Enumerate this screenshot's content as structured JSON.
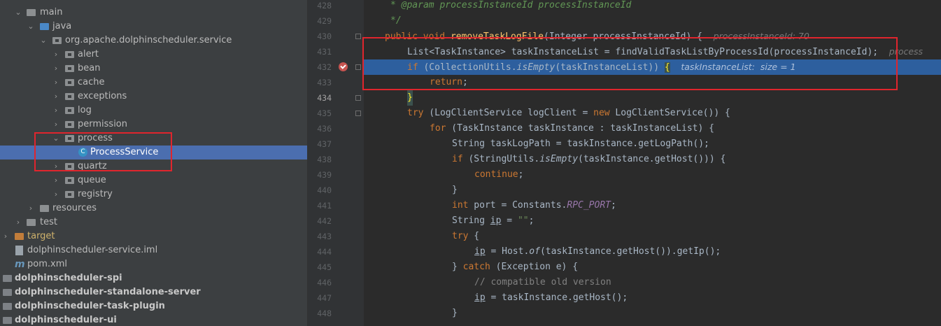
{
  "tree": {
    "items": [
      {
        "label": "main",
        "kind": "folder",
        "expanded": true
      },
      {
        "label": "java",
        "kind": "folder",
        "expanded": true
      },
      {
        "label": "org.apache.dolphinscheduler.service",
        "kind": "package",
        "expanded": true
      },
      {
        "label": "alert",
        "kind": "package",
        "expanded": false
      },
      {
        "label": "bean",
        "kind": "package",
        "expanded": false
      },
      {
        "label": "cache",
        "kind": "package",
        "expanded": false
      },
      {
        "label": "exceptions",
        "kind": "package",
        "expanded": false
      },
      {
        "label": "log",
        "kind": "package",
        "expanded": false
      },
      {
        "label": "permission",
        "kind": "package",
        "expanded": false
      },
      {
        "label": "process",
        "kind": "package",
        "expanded": true
      },
      {
        "label": "ProcessService",
        "kind": "class",
        "selected": true
      },
      {
        "label": "quartz",
        "kind": "package",
        "expanded": false
      },
      {
        "label": "queue",
        "kind": "package",
        "expanded": false
      },
      {
        "label": "registry",
        "kind": "package",
        "expanded": false
      },
      {
        "label": "resources",
        "kind": "folder",
        "expanded": false
      },
      {
        "label": "test",
        "kind": "folder",
        "expanded": false
      },
      {
        "label": "target",
        "kind": "folder-excluded",
        "expanded": false
      },
      {
        "label": "dolphinscheduler-service.iml",
        "kind": "iml"
      },
      {
        "label": "pom.xml",
        "kind": "maven"
      },
      {
        "label": "dolphinscheduler-spi",
        "kind": "module"
      },
      {
        "label": "dolphinscheduler-standalone-server",
        "kind": "module"
      },
      {
        "label": "dolphinscheduler-task-plugin",
        "kind": "module"
      },
      {
        "label": "dolphinscheduler-ui",
        "kind": "module"
      }
    ]
  },
  "editor": {
    "line_numbers": [
      "428",
      "429",
      "430",
      "431",
      "432",
      "433",
      "434",
      "435",
      "436",
      "437",
      "438",
      "439",
      "440",
      "441",
      "442",
      "443",
      "444",
      "445",
      "446",
      "447",
      "448"
    ],
    "current_line": "432",
    "breakpoint_line": "432",
    "lines": {
      "l428": {
        "javadoc": "* @param processInstanceId processInstanceId",
        "tag": "@param"
      },
      "l429": {
        "javadoc_end": "*/"
      },
      "l430": {
        "kw1": "public",
        "kw2": "void",
        "method": "removeTaskLogFile",
        "rest": "(Integer processInstanceId) {",
        "hint": "processInstanceId: 70"
      },
      "l431": {
        "code": "List<TaskInstance> taskInstanceList = findValidTaskListByProcessId(processInstanceId);",
        "hint": "process"
      },
      "l432": {
        "kw": "if",
        "pre": " (CollectionUtils.",
        "call": "isEmpty",
        "post": "(taskInstanceList)) ",
        "brace": "{",
        "hint": "taskInstanceList:  size = 1"
      },
      "l433": {
        "kw": "return",
        "post": ";"
      },
      "l434": {
        "brace": "}"
      },
      "l435": {
        "kw": "try",
        "pre": " (LogClientService logClient = ",
        "kw2": "new",
        "post": " LogClientService()) {"
      },
      "l436": {
        "kw": "for",
        "post": " (TaskInstance taskInstance : taskInstanceList) {"
      },
      "l437": {
        "code": "String taskLogPath = taskInstance.getLogPath();"
      },
      "l438": {
        "kw": "if",
        "pre": " (StringUtils.",
        "call": "isEmpty",
        "post": "(taskInstance.getHost())) {"
      },
      "l439": {
        "kw": "continue",
        "post": ";"
      },
      "l440": {
        "code": "}"
      },
      "l441": {
        "kw": "int",
        "pre": " port = Constants.",
        "const": "RPC_PORT",
        "post": ";"
      },
      "l442": {
        "pre": "String ",
        "var": "ip",
        "mid": " = ",
        "str": "\"\"",
        "post": ";"
      },
      "l443": {
        "kw": "try",
        "post": " {"
      },
      "l444": {
        "var": "ip",
        "pre": " = Host.",
        "call": "of",
        "post": "(taskInstance.getHost()).getIp();"
      },
      "l445": {
        "pre": "} ",
        "kw": "catch",
        "post": " (Exception e) {"
      },
      "l446": {
        "comment": "// compatible old version"
      },
      "l447": {
        "var": "ip",
        "post": " = taskInstance.getHost();"
      },
      "l448": {
        "code": "}"
      }
    }
  },
  "colors": {
    "highlight_box": "#e0252d",
    "selection": "#4b6eaf",
    "execution_line": "#2d5f9e",
    "keyword": "#cc7832",
    "method": "#ffc66d"
  }
}
